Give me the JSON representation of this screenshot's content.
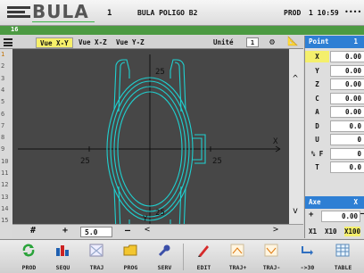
{
  "header": {
    "logo_text": "BULA",
    "program_number": "1",
    "program_name": "BULA POLIGO B2",
    "mode": "PROD",
    "clock": "1 10:59",
    "dots": "••••"
  },
  "status_bar": {
    "text": "16"
  },
  "view_tabs": [
    {
      "label": "Vue X-Y",
      "active": true
    },
    {
      "label": "Vue X-Z",
      "active": false
    },
    {
      "label": "Vue Y-Z",
      "active": false
    }
  ],
  "unit": {
    "label": "Unité",
    "value": "1"
  },
  "line_numbers": [
    "1",
    "2",
    "3",
    "4",
    "5",
    "6",
    "7",
    "8",
    "9",
    "10",
    "11",
    "12",
    "13",
    "14",
    "15"
  ],
  "canvas": {
    "axis_labels": {
      "y_top": "25",
      "x_left": "25",
      "x_right": "25",
      "x_axis": "X",
      "y_axis": "Y",
      "y_bottom": "25"
    },
    "bg_color": "#474747",
    "shape_color": "#1fd0d0"
  },
  "zoom": {
    "hash": "#",
    "plus": "+",
    "value": "5.0",
    "minus": "—",
    "left_arrow": "<",
    "right_arrow": ">"
  },
  "point_panel": {
    "title": "Point",
    "index": "1",
    "rows": [
      {
        "key": "X",
        "value": "0.00",
        "selected": true
      },
      {
        "key": "Y",
        "value": "0.00",
        "selected": false
      },
      {
        "key": "Z",
        "value": "0.00",
        "selected": false
      },
      {
        "key": "C",
        "value": "0.00",
        "selected": false
      },
      {
        "key": "A",
        "value": "0.00",
        "selected": false
      },
      {
        "key": "D",
        "value": "0.0",
        "selected": false
      },
      {
        "key": "U",
        "value": "0",
        "selected": false
      },
      {
        "key": "% F",
        "value": "0",
        "selected": false
      },
      {
        "key": "T",
        "value": "0.0",
        "selected": false
      }
    ]
  },
  "axe_panel": {
    "title": "Axe",
    "axis": "X",
    "plus": "+",
    "value": "0.00",
    "dash": "—",
    "steps": [
      "X1",
      "X10",
      "X100"
    ]
  },
  "footer": {
    "keys": [
      {
        "label": "PROD",
        "icon": "refresh-icon"
      },
      {
        "label": "SEQU",
        "icon": "sequence-icon"
      },
      {
        "label": "TRAJ",
        "icon": "trajectory-icon"
      },
      {
        "label": "PROG",
        "icon": "folder-icon"
      },
      {
        "label": "SERV",
        "icon": "wrench-icon"
      },
      {
        "label": "EDIT",
        "icon": "pencil-icon"
      },
      {
        "label": "TRAJ+",
        "icon": "trajectory-plus-icon"
      },
      {
        "label": "TRAJ-",
        "icon": "trajectory-minus-icon"
      },
      {
        "label": "->30",
        "icon": "arrow-30-icon"
      },
      {
        "label": "TABLE",
        "icon": "table-icon"
      }
    ]
  }
}
